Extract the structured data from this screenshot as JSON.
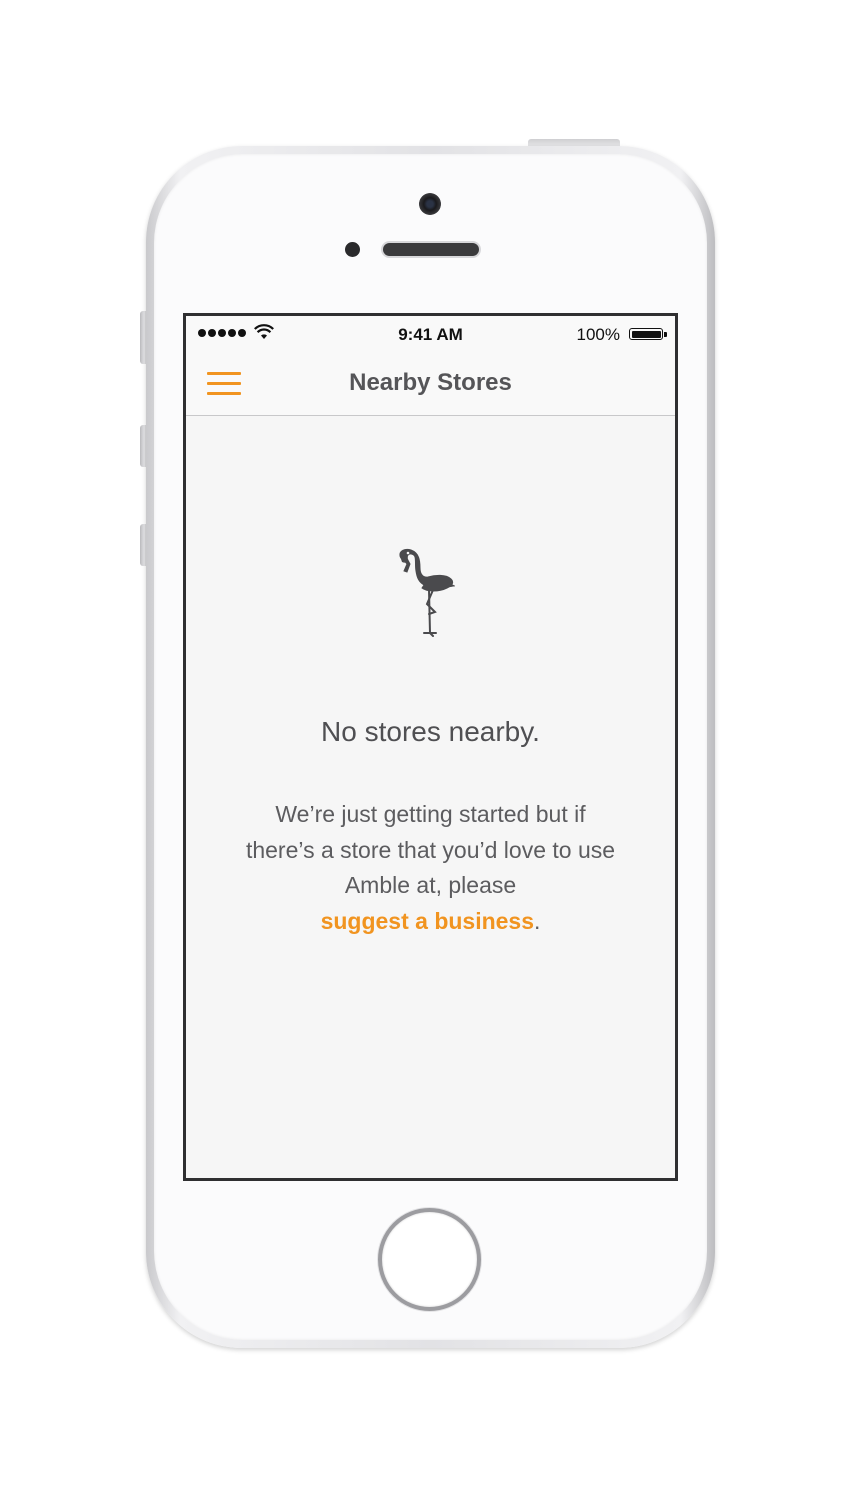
{
  "status_bar": {
    "time": "9:41 AM",
    "battery_percent": "100%",
    "signal_dots": 5,
    "wifi_icon": "wifi-icon",
    "battery_icon": "battery-icon"
  },
  "nav": {
    "title": "Nearby Stores",
    "menu_icon": "hamburger-menu-icon"
  },
  "empty_state": {
    "icon": "flamingo-icon",
    "title": "No stores nearby.",
    "body_line1": "We’re just getting started but if",
    "body_line2": "there’s a store that you’d love to use",
    "body_line3": "Amble at, please",
    "link_text": "suggest a business",
    "link_suffix": "."
  },
  "colors": {
    "accent": "#f19420",
    "title_text": "#555558",
    "body_text": "#5c5c5f",
    "screen_background": "#f6f6f6",
    "icon_gray": "#4a4a4d"
  }
}
